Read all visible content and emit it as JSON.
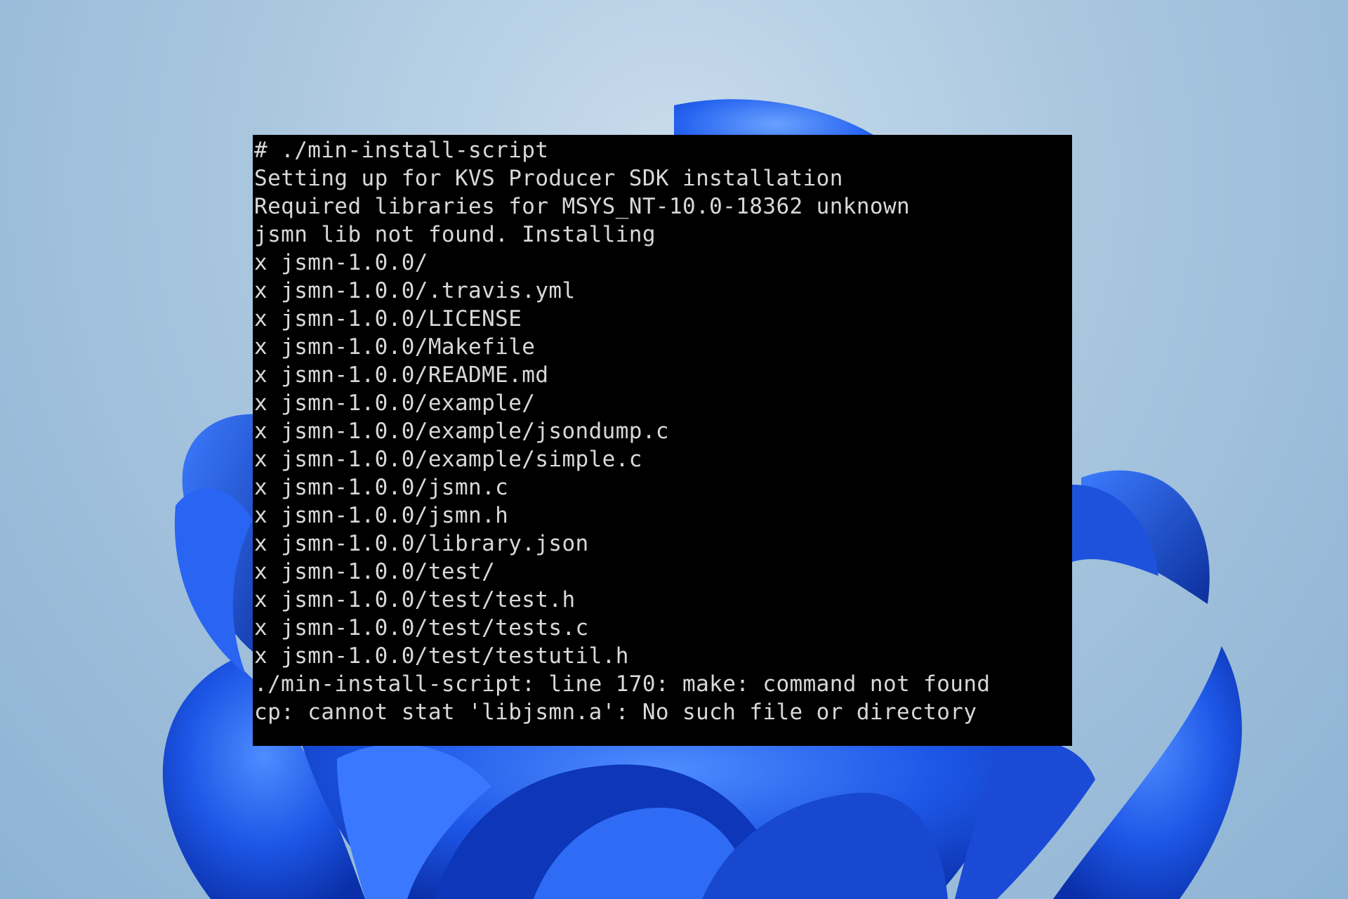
{
  "terminal": {
    "lines": [
      "# ./min-install-script",
      "Setting up for KVS Producer SDK installation",
      "Required libraries for MSYS_NT-10.0-18362 unknown",
      "jsmn lib not found. Installing",
      "x jsmn-1.0.0/",
      "x jsmn-1.0.0/.travis.yml",
      "x jsmn-1.0.0/LICENSE",
      "x jsmn-1.0.0/Makefile",
      "x jsmn-1.0.0/README.md",
      "x jsmn-1.0.0/example/",
      "x jsmn-1.0.0/example/jsondump.c",
      "x jsmn-1.0.0/example/simple.c",
      "x jsmn-1.0.0/jsmn.c",
      "x jsmn-1.0.0/jsmn.h",
      "x jsmn-1.0.0/library.json",
      "x jsmn-1.0.0/test/",
      "x jsmn-1.0.0/test/test.h",
      "x jsmn-1.0.0/test/tests.c",
      "x jsmn-1.0.0/test/testutil.h",
      "./min-install-script: line 170: make: command not found",
      "cp: cannot stat 'libjsmn.a': No such file or directory"
    ],
    "text_color": "#d8d8d8",
    "background_color": "#000000"
  },
  "wallpaper": {
    "name": "Windows 11 bloom wallpaper",
    "accent_color": "#1f5ae8",
    "sky_color": "#a9c6df"
  }
}
